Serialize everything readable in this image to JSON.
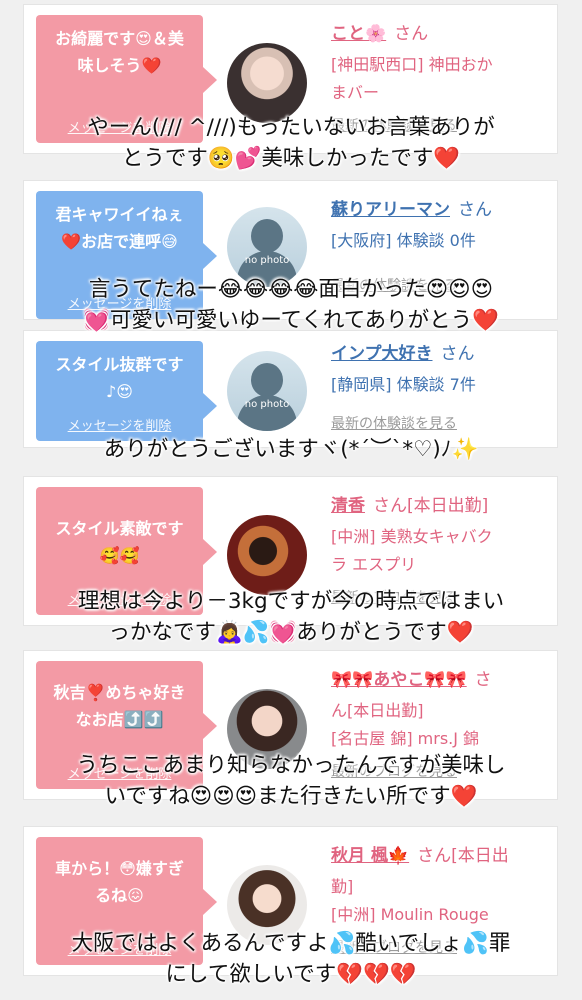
{
  "cards": [
    {
      "bubble_lines": [
        "お綺麗です😍＆美",
        "味しそう❤️"
      ],
      "delete_label": "メッセージを削除",
      "user_name": "こと🌸",
      "san": "さん",
      "location_lines": [
        "[神田駅西口] 神田おか",
        "まバー"
      ],
      "latest_label": "最新の体験談を見る",
      "overlay_lines": [
        "やーん(/// ^///)もったいないお言葉ありが",
        "とうです🥺💕美味しかったです❤️"
      ]
    },
    {
      "bubble_lines": [
        "君キャワイイねぇ",
        "❤️お店で連呼😅"
      ],
      "delete_label": "メッセージを削除",
      "user_name": "蘇りアリーマン",
      "san": "さん",
      "location_lines": [
        "[大阪府] 体験談 0件"
      ],
      "latest_label": "最新の体験談を見る",
      "no_photo": "no photo",
      "overlay_lines": [
        "言うてたねー😂😂😂😂面白かった😍😍😍",
        "💓可愛い可愛いゆーてくれてありがとう❤️"
      ]
    },
    {
      "bubble_lines": [
        "スタイル抜群です",
        "♪😍"
      ],
      "delete_label": "メッセージを削除",
      "user_name": "インプ大好き",
      "san": "さん",
      "location_lines": [
        "[静岡県] 体験談 7件"
      ],
      "latest_label": "最新の体験談を見る",
      "no_photo": "no photo",
      "overlay_lines": [
        "ありがとうございますヾ(*´︶`*♡)ﾉ✨"
      ]
    },
    {
      "bubble_lines": [
        "スタイル素敵です",
        "🥰🥰"
      ],
      "delete_label": "メッセージを削除",
      "user_name": "清香",
      "san": "さん[本日出勤]",
      "location_lines": [
        "[中洲] 美熟女キャバク",
        "ラ エスプリ"
      ],
      "latest_label": "最新のブログを見る",
      "overlay_lines": [
        "理想は今より－3kgですが今の時点ではまい",
        "っかなです🙇‍♀️💦💓ありがとうです❤️"
      ]
    },
    {
      "bubble_lines": [
        "秋吉❣️めちゃ好き",
        "なお店⤴️⤴️"
      ],
      "delete_label": "メッセージを削除",
      "user_name": "🎀🎀あやこ🎀🎀",
      "san": "さ",
      "name_line2": "ん[本日出勤]",
      "location_lines": [
        "[名古屋 錦] mrs.J 錦"
      ],
      "latest_label": "最新のブログを見る",
      "overlay_lines": [
        "うちここあまり知らなかったんですが美味し",
        "いですね😍😍😍また行きたい所です❤️"
      ]
    },
    {
      "bubble_lines": [
        "車から！😳嫌すぎ",
        "るね😖"
      ],
      "delete_label": "メッセージを削除",
      "user_name": "秋月 楓🍁",
      "san": "さん[本日出",
      "name_line2": "勤]",
      "location_lines": [
        "[中洲] Moulin Rouge"
      ],
      "latest_label": "最新のブログを見る",
      "overlay_lines": [
        "大阪ではよくあるんですよ💦酷いでしょ💦罪",
        "にして欲しいです💔💔💔"
      ]
    }
  ],
  "colors": {
    "bubble_pink": "#f39aa5",
    "bubble_blue": "#7fb3ee",
    "name_pink": "#e06480",
    "name_blue": "#3f72b0"
  }
}
